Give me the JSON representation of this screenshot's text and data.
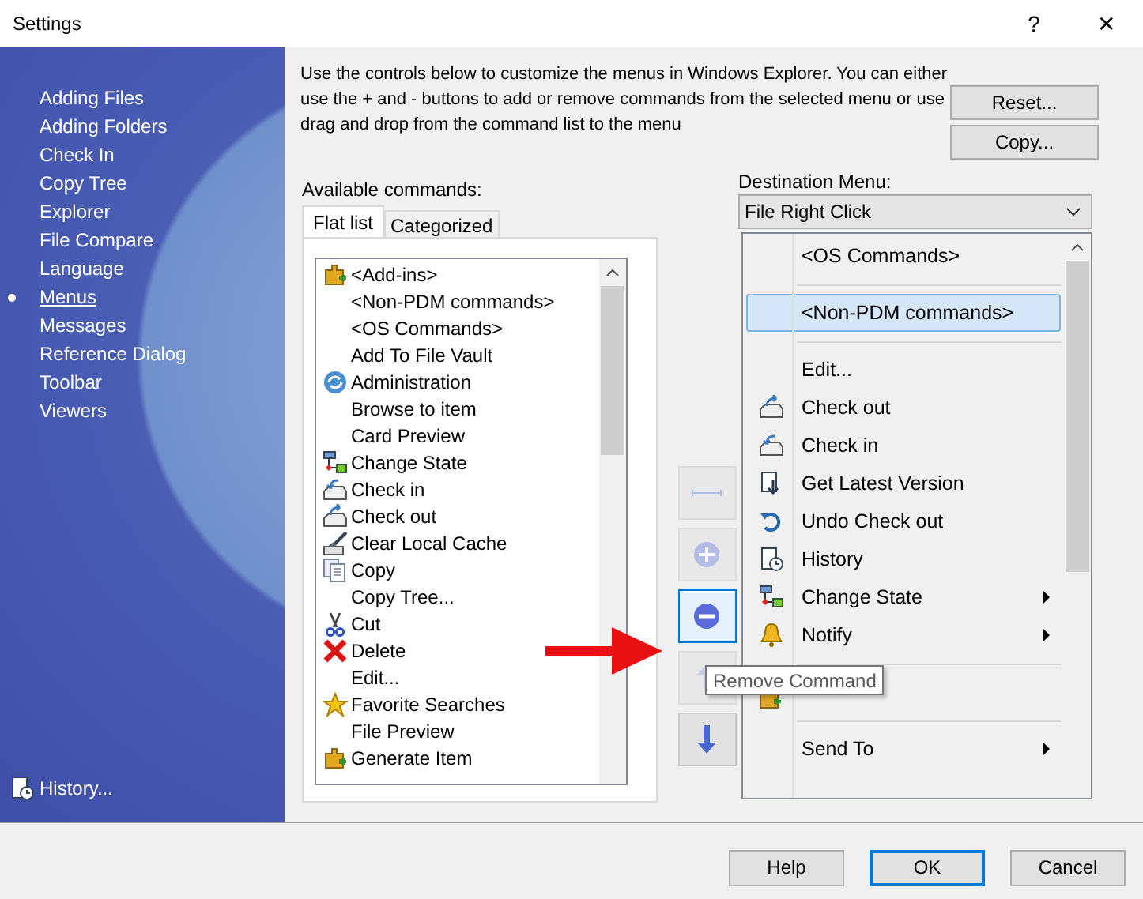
{
  "window": {
    "title": "Settings",
    "help": "?",
    "close": "✕"
  },
  "sidebar": {
    "items": [
      {
        "label": "Adding Files",
        "selected": false
      },
      {
        "label": "Adding Folders",
        "selected": false
      },
      {
        "label": "Check In",
        "selected": false
      },
      {
        "label": "Copy Tree",
        "selected": false
      },
      {
        "label": "Explorer",
        "selected": false
      },
      {
        "label": "File Compare",
        "selected": false
      },
      {
        "label": "Language",
        "selected": false
      },
      {
        "label": "Menus",
        "selected": true
      },
      {
        "label": "Messages",
        "selected": false
      },
      {
        "label": "Reference Dialog",
        "selected": false
      },
      {
        "label": "Toolbar",
        "selected": false
      },
      {
        "label": "Viewers",
        "selected": false
      }
    ],
    "history": "History..."
  },
  "description": "Use the controls below to customize the menus in Windows Explorer. You can either use the + and - buttons to add or remove commands from the selected menu or use drag and drop from the command list to the menu",
  "buttons_top": [
    "Reset...",
    "Copy..."
  ],
  "available": {
    "label": "Available commands:",
    "tabs": [
      {
        "label": "Flat list",
        "selected": true
      },
      {
        "label": "Categorized",
        "selected": false
      }
    ],
    "items": [
      "<Add-ins>",
      "<Non-PDM commands>",
      "<OS Commands>",
      "Add To File Vault",
      "Administration",
      "Browse to item",
      "Card Preview",
      "Change State",
      "Check in",
      "Check out",
      "Clear Local Cache",
      "Copy",
      "Copy Tree...",
      "Cut",
      "Delete",
      "Edit...",
      "Favorite Searches",
      "File Preview",
      "Generate Item"
    ]
  },
  "move_buttons": [
    {
      "kind": "separator",
      "disabled": true,
      "focused": false
    },
    {
      "kind": "add",
      "disabled": true,
      "focused": false
    },
    {
      "kind": "remove",
      "disabled": false,
      "focused": true
    },
    {
      "kind": "up",
      "disabled": true,
      "focused": false
    },
    {
      "kind": "down",
      "disabled": false,
      "focused": false
    }
  ],
  "tooltip": "Remove Command",
  "destination": {
    "label": "Destination Menu:",
    "value": "File Right Click",
    "items": [
      {
        "kind": "item",
        "label": "<OS Commands>",
        "submenu": false,
        "selected": false
      },
      {
        "kind": "separator"
      },
      {
        "kind": "item",
        "label": "<Non-PDM commands>",
        "submenu": false,
        "selected": true
      },
      {
        "kind": "separator"
      },
      {
        "kind": "item",
        "label": "Edit...",
        "submenu": false,
        "selected": false
      },
      {
        "kind": "item",
        "label": "Check out",
        "submenu": false,
        "selected": false
      },
      {
        "kind": "item",
        "label": "Check in",
        "submenu": false,
        "selected": false
      },
      {
        "kind": "item",
        "label": "Get Latest Version",
        "submenu": false,
        "selected": false
      },
      {
        "kind": "item",
        "label": "Undo Check out",
        "submenu": false,
        "selected": false
      },
      {
        "kind": "item",
        "label": "History",
        "submenu": false,
        "selected": false
      },
      {
        "kind": "item",
        "label": "Change State",
        "submenu": true,
        "selected": false
      },
      {
        "kind": "item",
        "label": "Notify",
        "submenu": true,
        "selected": false
      },
      {
        "kind": "separator"
      },
      {
        "kind": "covered"
      },
      {
        "kind": "separator"
      },
      {
        "kind": "item",
        "label": "Send To",
        "submenu": true,
        "selected": false
      }
    ]
  },
  "footer": [
    {
      "label": "Help",
      "default": false
    },
    {
      "label": "OK",
      "default": true
    },
    {
      "label": "Cancel",
      "default": false
    }
  ]
}
